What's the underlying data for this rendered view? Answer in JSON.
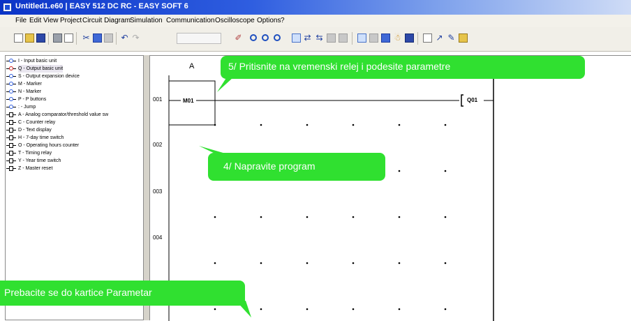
{
  "window": {
    "title": "Untitled1.e60 | EASY 512 DC RC - EASY SOFT 6"
  },
  "menu": [
    "File",
    "Edit",
    "View",
    "Project",
    "Circuit Diagram",
    "Simulation",
    "Communication",
    "Oscilloscope",
    "Options",
    "?"
  ],
  "toolbar": {
    "icons": [
      "new-document-icon",
      "open-folder-icon",
      "save-icon",
      "print-icon",
      "print-preview-icon",
      "cut-icon",
      "copy-icon",
      "paste-icon",
      "undo-icon",
      "redo-icon",
      "zoom-combo",
      "pen-icon",
      "zoom-in-icon",
      "zoom-out-icon",
      "zoom-fit-icon",
      "insert-row-icon",
      "insert-column-icon",
      "connect-icon",
      "delete-icon",
      "cross-icon",
      "grid-view-icon",
      "list-view-icon",
      "circuit-view-icon",
      "parameters-icon",
      "table-icon",
      "rectangle-icon",
      "line-icon",
      "pencil-icon",
      "note-icon"
    ]
  },
  "legend": {
    "items": [
      {
        "label": "I - Input basic unit",
        "icon": "contact-blue"
      },
      {
        "label": "Q - Output basic unit",
        "icon": "contact-red"
      },
      {
        "label": "S - Output expansion device",
        "icon": "contact-blue"
      },
      {
        "label": "M - Marker",
        "icon": "contact-blue"
      },
      {
        "label": "N - Marker",
        "icon": "contact-blue"
      },
      {
        "label": "P - P buttons",
        "icon": "contact-blue"
      },
      {
        "label": ": - Jump",
        "icon": "contact-blue"
      },
      {
        "label": "A - Analog comparator/threshold value sw",
        "icon": "function-block"
      },
      {
        "label": "C - Counter relay",
        "icon": "function-block"
      },
      {
        "label": "D - Text display",
        "icon": "function-block"
      },
      {
        "label": "H - 7-day time switch",
        "icon": "function-block"
      },
      {
        "label": "O - Operating hours counter",
        "icon": "function-block"
      },
      {
        "label": "T - Timing relay",
        "icon": "function-block"
      },
      {
        "label": "Y - Year time switch",
        "icon": "function-block"
      },
      {
        "label": "Z - Master reset",
        "icon": "function-block"
      }
    ]
  },
  "diagram": {
    "column_header": "A",
    "rows": [
      "001",
      "002",
      "003",
      "004"
    ],
    "contact": "M01",
    "coil": "Q01"
  },
  "callouts": {
    "step5": "5/   Pritisnite na vremenski relej i podesite parametre",
    "step4": "4/   Napravite program",
    "tab": "Prebacite se do kartice Parametar"
  },
  "colors": {
    "callout": "#30e030",
    "title_bar": "#0b34c8",
    "coil_bracket": "#000000"
  }
}
